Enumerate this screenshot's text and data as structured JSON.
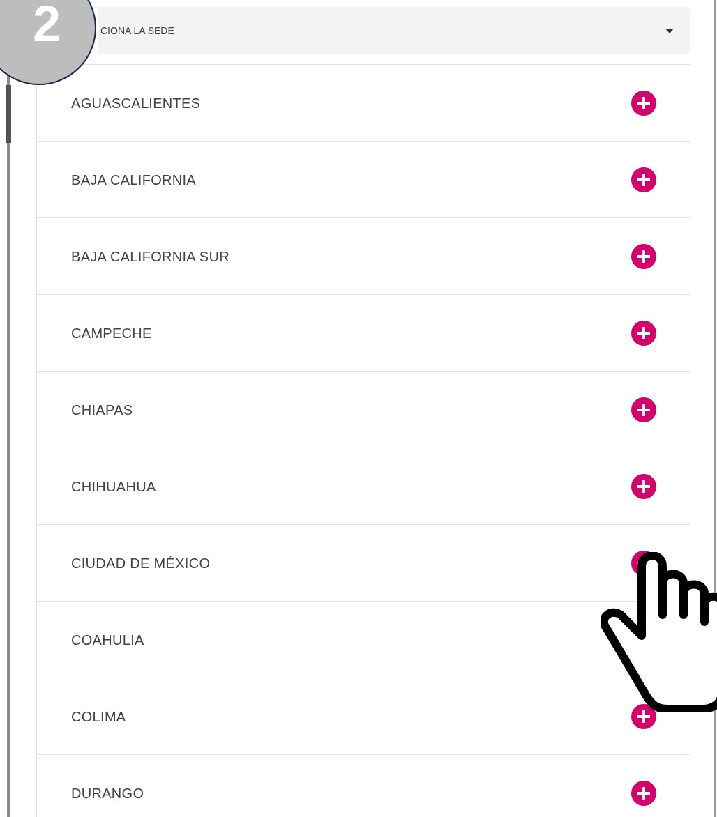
{
  "step_badge": "2",
  "select": {
    "value": "CIONA LA SEDE"
  },
  "locations": [
    {
      "name": "AGUASCALIENTES"
    },
    {
      "name": "BAJA CALIFORNIA"
    },
    {
      "name": "BAJA CALIFORNIA SUR"
    },
    {
      "name": "CAMPECHE"
    },
    {
      "name": "CHIAPAS"
    },
    {
      "name": "CHIHUAHUA"
    },
    {
      "name": "CIUDAD DE MÉXICO"
    },
    {
      "name": "COAHULIA"
    },
    {
      "name": "COLIMA"
    },
    {
      "name": "DURANGO"
    }
  ]
}
